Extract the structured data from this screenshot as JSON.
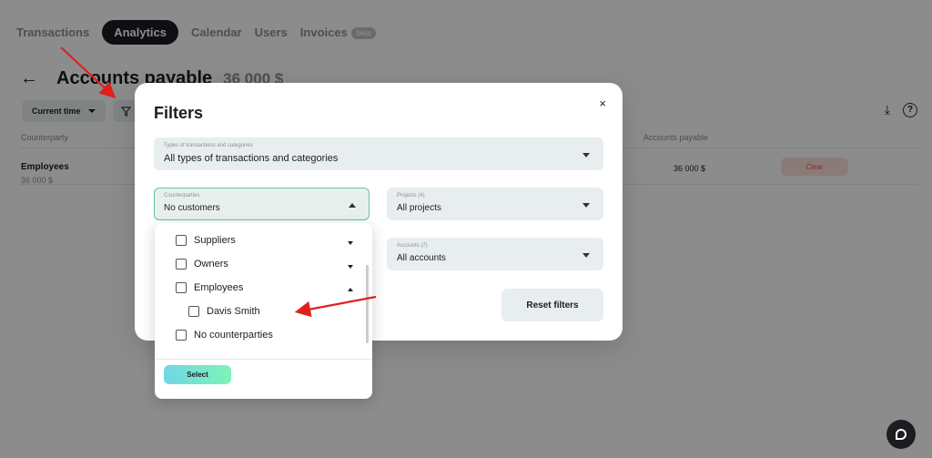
{
  "nav": {
    "tabs": [
      "Transactions",
      "Analytics",
      "Calendar",
      "Users",
      "Invoices"
    ],
    "beta_badge": "beta"
  },
  "page": {
    "title": "Accounts payable",
    "amount": "36 000 $",
    "time_filter": "Current time"
  },
  "table": {
    "col_counterparty": "Counterparty",
    "col_accounts_payable": "Accounts payable",
    "row": {
      "name": "Employees",
      "sub": "36 000 $",
      "amount": "36 000 $",
      "action": "Clear"
    }
  },
  "modal": {
    "title": "Filters",
    "close": "×",
    "types_label": "Types of transactions and categories",
    "types_value": "All types of transactions and categories",
    "counterparties_label": "Counterparties",
    "counterparties_value": "No customers",
    "projects_label": "Projects (4)",
    "projects_value": "All projects",
    "accounts_label": "Accounts (7)",
    "accounts_value": "All accounts",
    "reset_button": "Reset filters"
  },
  "dropdown": {
    "items": [
      {
        "label": "Suppliers",
        "caret": "down"
      },
      {
        "label": "Owners",
        "caret": "down"
      },
      {
        "label": "Employees",
        "caret": "up"
      },
      {
        "label": "Davis Smith",
        "caret": ""
      },
      {
        "label": "No counterparties",
        "caret": ""
      }
    ],
    "select_button": "Select"
  },
  "colors": {
    "accent_green": "#5fc79a",
    "annotation_red": "#e02020",
    "clear_red": "#e35f45"
  }
}
